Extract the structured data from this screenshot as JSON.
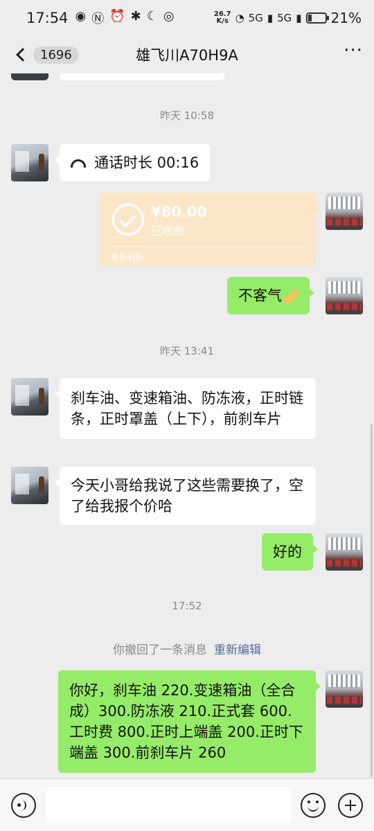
{
  "status_bar": {
    "time": "17:54",
    "net_speed_value": "26.7",
    "net_speed_unit": "K/s",
    "signal1": "5G",
    "signal2": "5G",
    "battery_pct": "21%",
    "battery_level": 0.21
  },
  "nav": {
    "unread_count": "1696",
    "title": "雄飞川A70H9A",
    "more": "···"
  },
  "messages": {
    "ts1": "昨天 10:58",
    "call_text": "通话时长 00:16",
    "transfer_amount": "¥80.00",
    "transfer_status": "已收款",
    "transfer_source": "微信转账",
    "reply1": "不客气",
    "ts2": "昨天 13:41",
    "friend_msg1": "刹车油、变速箱油、防冻液，正时链条，正时罩盖（上下），前刹车片",
    "friend_msg2": "今天小哥给我说了这些需要换了，空了给我报个价哈",
    "reply2": "好的",
    "ts3": "17:52",
    "recall_text": "你撤回了一条消息",
    "recall_edit": "重新编辑",
    "quote": "你好，刹车油 220.变速箱油（全合成）300.防冻液 210.正式套 600.工时费 800.正时上端盖 200.正时下端盖 300.前刹车片 260"
  },
  "icons": {
    "back": "back-arrow-icon",
    "voice": "voice-icon",
    "emoji": "emoji-icon",
    "plus": "plus-icon"
  },
  "colors": {
    "bg": "#ededed",
    "my_bubble": "#95ec69",
    "friend_bubble": "#ffffff",
    "transfer": "#fbe7c7",
    "link": "#576b95"
  }
}
